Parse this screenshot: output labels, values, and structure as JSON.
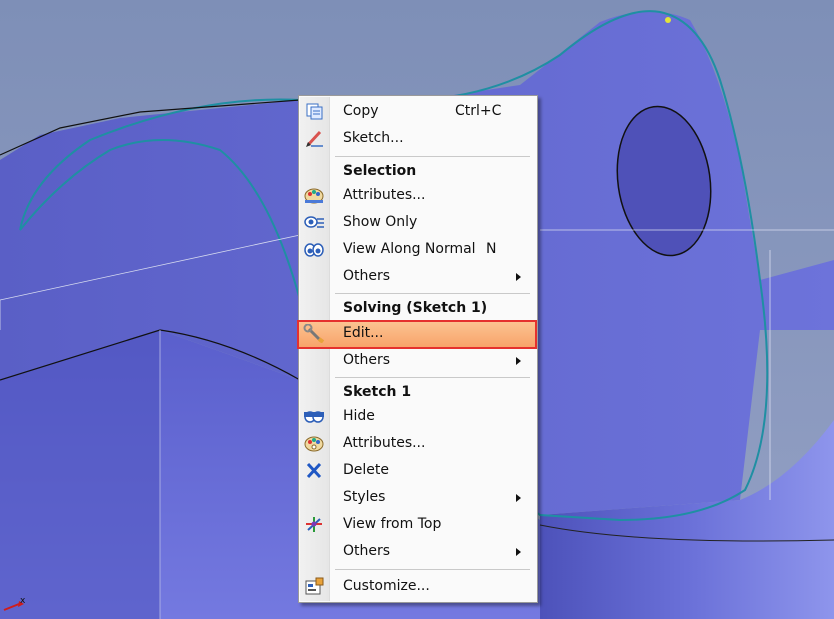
{
  "axis": {
    "label": "x"
  },
  "menu": {
    "items": [
      {
        "id": "copy",
        "label": "Copy",
        "shortcut": "Ctrl+C",
        "icon": "copy-icon"
      },
      {
        "id": "sketch",
        "label": "Sketch...",
        "icon": "pencil-icon"
      },
      {
        "id": "sel-attributes",
        "label": "Attributes...",
        "icon": "palette-icon"
      },
      {
        "id": "show-only",
        "label": "Show Only",
        "icon": "show-only-icon"
      },
      {
        "id": "view-along-normal",
        "label": "View Along Normal",
        "shortcut": "N",
        "icon": "view-normal-icon"
      },
      {
        "id": "sel-others",
        "label": "Others",
        "submenu": true
      },
      {
        "id": "edit",
        "label": "Edit...",
        "icon": "wrench-icon",
        "highlighted": true
      },
      {
        "id": "solving-others",
        "label": "Others",
        "submenu": true
      },
      {
        "id": "hide",
        "label": "Hide",
        "icon": "hide-icon"
      },
      {
        "id": "sketch-attributes",
        "label": "Attributes...",
        "icon": "palette-icon"
      },
      {
        "id": "delete",
        "label": "Delete",
        "icon": "delete-x-icon"
      },
      {
        "id": "styles",
        "label": "Styles",
        "submenu": true
      },
      {
        "id": "view-from-top",
        "label": "View from Top",
        "icon": "view-top-icon"
      },
      {
        "id": "sketch-others",
        "label": "Others",
        "submenu": true
      },
      {
        "id": "customize",
        "label": "Customize...",
        "icon": "customize-icon"
      }
    ],
    "headers": {
      "selection": "Selection",
      "solving": "Solving (Sketch 1)",
      "sketch": "Sketch 1"
    }
  },
  "colors": {
    "highlight_border": "#e5312e",
    "highlight_fill": "#f9ae74",
    "model_face": "#6a6fd6",
    "sketch_curve": "#1f8fa3",
    "background": "#8390b8"
  }
}
